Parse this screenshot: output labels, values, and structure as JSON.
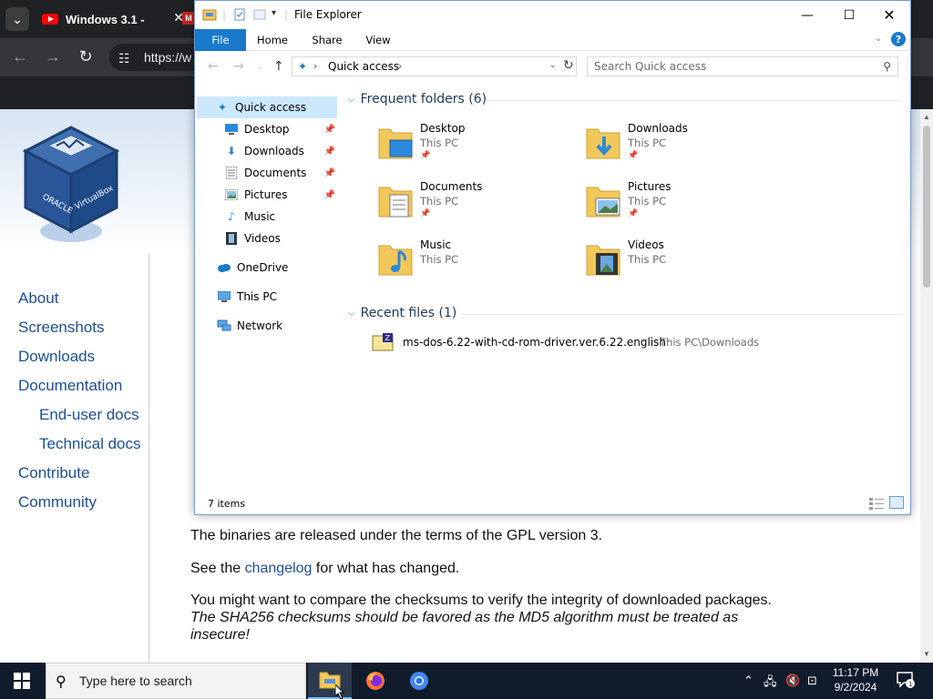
{
  "browser": {
    "tab_title": "Windows 3.1 -",
    "url": "https://w",
    "side_links": [
      "About",
      "Screenshots",
      "Downloads",
      "Documentation",
      "End-user docs",
      "Technical docs",
      "Contribute",
      "Community"
    ],
    "body": {
      "gpl": "The binaries are released under the terms of the GPL version 3.",
      "see": "See the ",
      "changelog": "changelog",
      "see_after": " for what has changed.",
      "compare": "You might want to compare the checksums to verify the integrity of downloaded packages.",
      "sha_line1": "The SHA256 checksums should be favored as the MD5 algorithm must be treated as",
      "sha_line2": "insecure!"
    }
  },
  "explorer": {
    "title": "File Explorer",
    "ribbon_tabs": [
      "File",
      "Home",
      "Share",
      "View"
    ],
    "address": "Quick access",
    "search_placeholder": "Search Quick access",
    "nav": [
      {
        "label": "Quick access",
        "icon": "star-icon",
        "selected": true
      },
      {
        "label": "Desktop",
        "icon": "desktop-icon",
        "pinned": true
      },
      {
        "label": "Downloads",
        "icon": "download-icon",
        "pinned": true
      },
      {
        "label": "Documents",
        "icon": "document-icon",
        "pinned": true
      },
      {
        "label": "Pictures",
        "icon": "pictures-icon",
        "pinned": true
      },
      {
        "label": "Music",
        "icon": "music-icon"
      },
      {
        "label": "Videos",
        "icon": "videos-icon"
      },
      {
        "label": "OneDrive",
        "icon": "cloud-icon"
      },
      {
        "label": "This PC",
        "icon": "computer-icon"
      },
      {
        "label": "Network",
        "icon": "network-icon"
      }
    ],
    "frequent_header": "Frequent folders (6)",
    "folders": [
      {
        "name": "Desktop",
        "location": "This PC",
        "pinned": true
      },
      {
        "name": "Downloads",
        "location": "This PC",
        "pinned": true
      },
      {
        "name": "Documents",
        "location": "This PC",
        "pinned": true
      },
      {
        "name": "Pictures",
        "location": "This PC",
        "pinned": true
      },
      {
        "name": "Music",
        "location": "This PC",
        "pinned": false
      },
      {
        "name": "Videos",
        "location": "This PC",
        "pinned": false
      }
    ],
    "recent_header": "Recent files (1)",
    "recent_files": [
      {
        "name": "ms-dos-6.22-with-cd-rom-driver.ver.6.22.english",
        "path": "This PC\\Downloads"
      }
    ],
    "status": "7 items"
  },
  "taskbar": {
    "search_placeholder": "Type here to search",
    "time": "11:17 PM",
    "date": "9/2/2024",
    "notification_count": "1"
  },
  "colors": {
    "accent": "#1979ca",
    "taskbar": "#101b2b",
    "link": "#1d4f91"
  }
}
